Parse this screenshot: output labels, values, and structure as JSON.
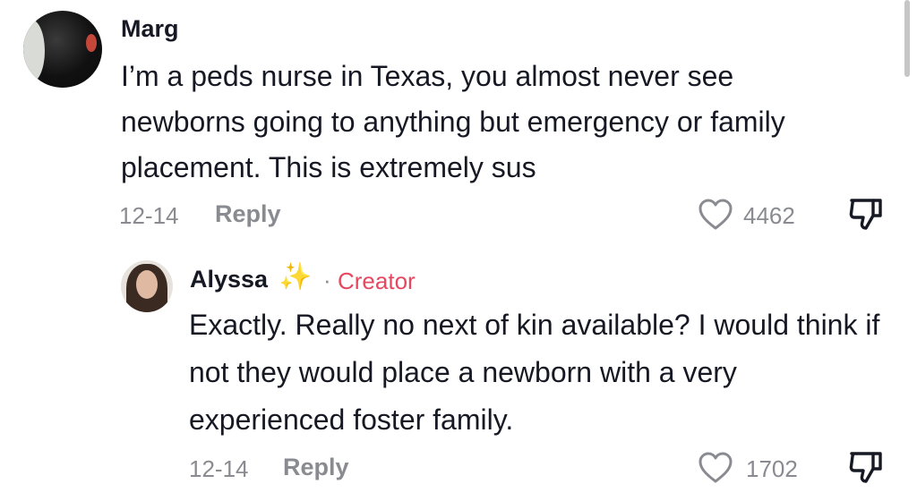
{
  "comments": [
    {
      "username": "Marg",
      "text": "I’m a peds nurse in Texas, you almost never see newborns going to anything but emergency or family placement. This is extremely sus",
      "date": "12-14",
      "reply_label": "Reply",
      "likes": "4462",
      "replies": [
        {
          "username": "Alyssa",
          "username_emoji": "✨",
          "separator": "·",
          "badge": "Creator",
          "text": "Exactly. Really no next of kin available? I would think if not they would place a newborn with a very experienced foster family.",
          "date": "12-14",
          "reply_label": "Reply",
          "likes": "1702"
        }
      ]
    }
  ],
  "icons": {
    "like": "heart-outline-icon",
    "dislike": "thumbs-down-outline-icon"
  },
  "colors": {
    "text_primary": "#161823",
    "text_secondary": "#8a8b91",
    "creator_badge": "#e5485f"
  }
}
